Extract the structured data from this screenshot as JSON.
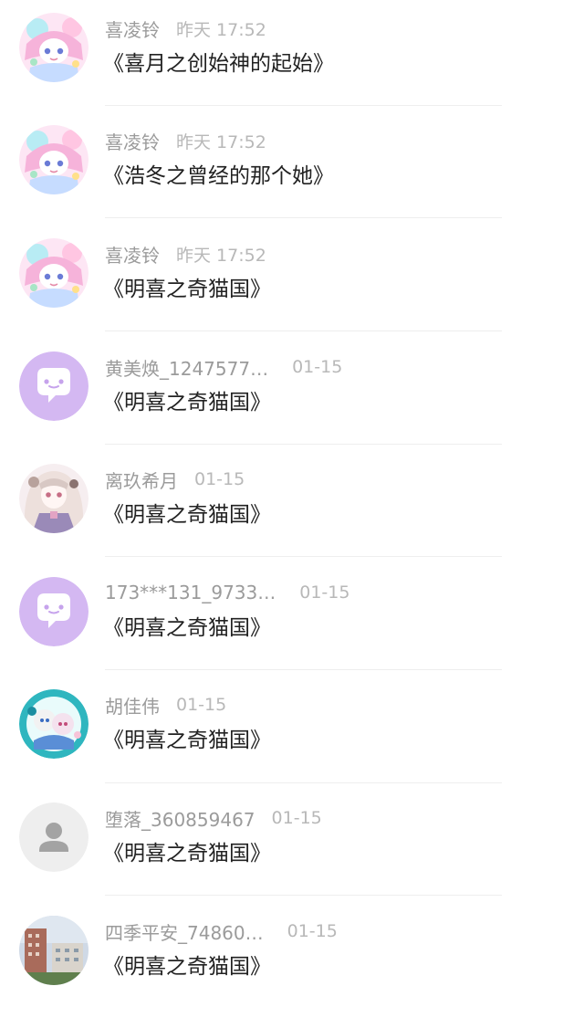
{
  "comments": [
    {
      "user": "喜凌铃",
      "time": "昨天 17:52",
      "text": "《喜月之创始神的起始》",
      "avatar": "anime-girl-pink-avatar"
    },
    {
      "user": "喜凌铃",
      "time": "昨天 17:52",
      "text": "《浩冬之曾经的那个她》",
      "avatar": "anime-girl-pink-avatar"
    },
    {
      "user": "喜凌铃",
      "time": "昨天 17:52",
      "text": "《明喜之奇猫国》",
      "avatar": "anime-girl-pink-avatar"
    },
    {
      "user": "黄美焕_1247577…",
      "time": "01-15",
      "text": "《明喜之奇猫国》",
      "avatar": "chat-bubble-icon"
    },
    {
      "user": "离玖希月",
      "time": "01-15",
      "text": "《明喜之奇猫国》",
      "avatar": "anime-girl-dress-avatar"
    },
    {
      "user": "173***131_9733…",
      "time": "01-15",
      "text": "《明喜之奇猫国》",
      "avatar": "chat-bubble-icon"
    },
    {
      "user": "胡佳伟",
      "time": "01-15",
      "text": "《明喜之奇猫国》",
      "avatar": "anime-pair-teal-avatar"
    },
    {
      "user": "堕落_360859467",
      "time": "01-15",
      "text": "《明喜之奇猫国》",
      "avatar": "default-person-icon"
    },
    {
      "user": "四季平安_74860…",
      "time": "01-15",
      "text": "《明喜之奇猫国》",
      "avatar": "buildings-photo-avatar"
    }
  ],
  "colors": {
    "username": "#9b9b9b",
    "timestamp": "#b8b8b8",
    "comment_text": "#222222",
    "chat_avatar_bg": "#d4b8f2",
    "default_avatar_bg": "#eeeeee"
  }
}
